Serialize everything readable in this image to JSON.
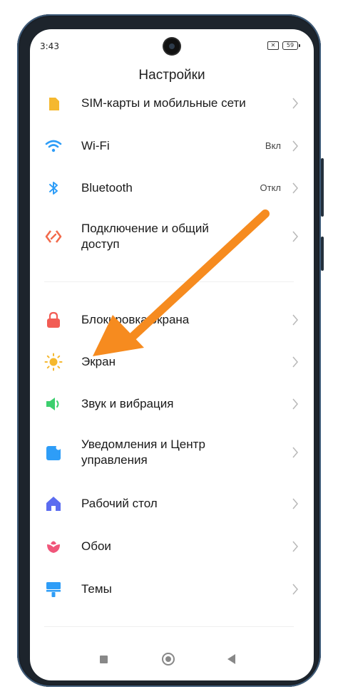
{
  "status_bar": {
    "time": "3:43",
    "battery_level": "59",
    "icons": [
      "sim-off-icon",
      "battery-icon"
    ]
  },
  "page": {
    "title": "Настройки"
  },
  "settings": {
    "sim": {
      "label": "SIM-карты и мобильные сети",
      "icon": "sim-card-icon",
      "color": "#f5b82e"
    },
    "wifi": {
      "label": "Wi-Fi",
      "value": "Вкл",
      "icon": "wifi-icon",
      "color": "#2e9df7"
    },
    "bluetooth": {
      "label": "Bluetooth",
      "value": "Откл",
      "icon": "bluetooth-icon",
      "color": "#2e9df7"
    },
    "sharing": {
      "label": "Подключение и общий доступ",
      "icon": "connection-sharing-icon",
      "color": "#f26a4b"
    },
    "lock": {
      "label": "Блокировка экрана",
      "icon": "lock-icon",
      "color": "#f25c54"
    },
    "display": {
      "label": "Экран",
      "icon": "sun-icon",
      "color": "#f5b82e"
    },
    "sound": {
      "label": "Звук и вибрация",
      "icon": "speaker-icon",
      "color": "#3ccf6e"
    },
    "notifications": {
      "label": "Уведомления и Центр управления",
      "icon": "notification-icon",
      "color": "#2e9df7"
    },
    "home": {
      "label": "Рабочий стол",
      "icon": "home-icon",
      "color": "#5b6cf0"
    },
    "wallpaper": {
      "label": "Обои",
      "icon": "flower-icon",
      "color": "#f0567a"
    },
    "themes": {
      "label": "Темы",
      "icon": "brush-icon",
      "color": "#2e9df7"
    }
  },
  "annotation": {
    "arrow_color": "#f68b1f",
    "points_to": "display"
  },
  "nav_bar": {
    "buttons": [
      "recents-icon",
      "home-button-icon",
      "back-icon"
    ]
  }
}
